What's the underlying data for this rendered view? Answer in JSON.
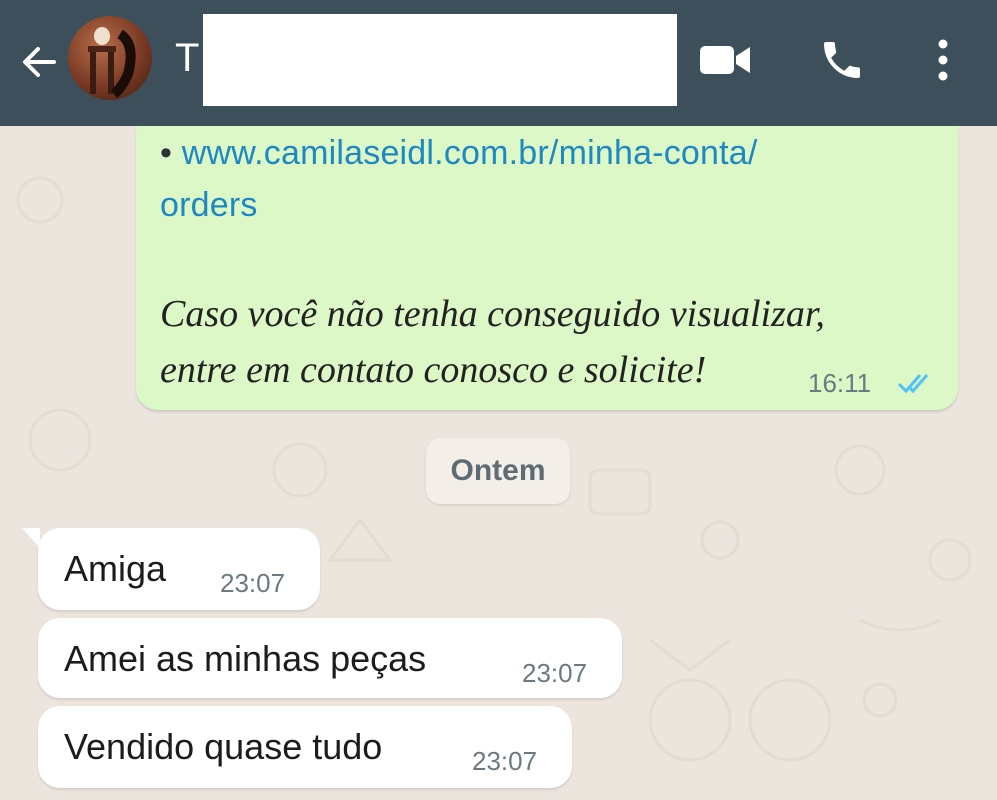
{
  "header": {
    "contact_initial": "T"
  },
  "messages_out": [
    {
      "link_line_1": "www.camilaseidl.com.br/minha-conta/",
      "link_line_2": "orders",
      "bullet": "•",
      "italic_line_1": "Caso você não tenha conseguido visualizar,",
      "italic_line_2": "entre em contato conosco e solicite!",
      "time": "16:11"
    }
  ],
  "date_separator": "Ontem",
  "messages_in": [
    {
      "text": "Amiga",
      "time": "23:07"
    },
    {
      "text": "Amei as minhas peças",
      "time": "23:07"
    },
    {
      "text": "Vendido quase tudo",
      "time": "23:07"
    }
  ],
  "colors": {
    "header_bg": "#3d4f5a",
    "outgoing_bubble": "#dcf8c6",
    "incoming_bubble": "#ffffff",
    "link": "#1e88c4",
    "read_ticks": "#4fc3f7",
    "chat_bg": "#ece5dd"
  },
  "icons": [
    "back-arrow-icon",
    "video-call-icon",
    "phone-icon",
    "more-vert-icon",
    "double-check-icon"
  ]
}
